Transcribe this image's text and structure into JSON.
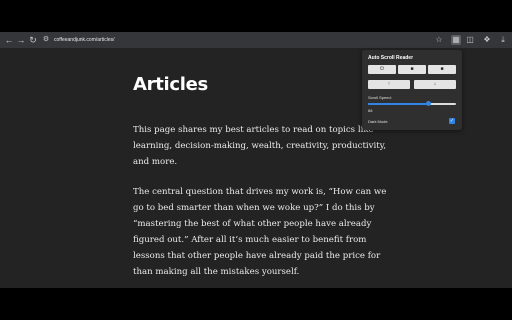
{
  "browser": {
    "url": "coffeeandjunk.com/articles/",
    "icons": {
      "back": "arrow-left-icon",
      "forward": "arrow-right-icon",
      "reload": "reload-icon",
      "site_info": "tune-icon",
      "bookmark": "star-icon",
      "extension": "auto-scroll-extension-icon",
      "side_panel": "side-panel-icon",
      "extensions": "puzzle-icon",
      "downloads": "download-icon"
    }
  },
  "article": {
    "title": "Articles",
    "paragraph_1": "This page shares my best articles to read on topics like learning, decision-making, wealth, creativity, productivity, and more.",
    "paragraph_2": "The central question that drives my work is, “How can we go to bed smarter than when we woke up?” I do this by “mastering the best of what other people have already figured out.” After all it’s much easier to benefit from lessons that other people have already paid the price for than making all the mistakes yourself."
  },
  "extension_popup": {
    "title": "Auto Scroll Reader",
    "buttons": [
      {
        "icon": "power-icon",
        "glyph": "⏻"
      },
      {
        "icon": "pause-icon",
        "glyph": "■"
      },
      {
        "icon": "stop-icon",
        "glyph": "■"
      },
      {
        "icon": "scroll-up-icon",
        "glyph": "↑"
      },
      {
        "icon": "scroll-down-icon",
        "glyph": "↓"
      }
    ],
    "scroll_speed_label": "Scroll Speed:",
    "scroll_speed_value": "68",
    "scroll_speed_fraction": 0.68,
    "dark_mode_label": "Dark Mode",
    "dark_mode_checked": true,
    "accent_color": "#2f84e6"
  }
}
